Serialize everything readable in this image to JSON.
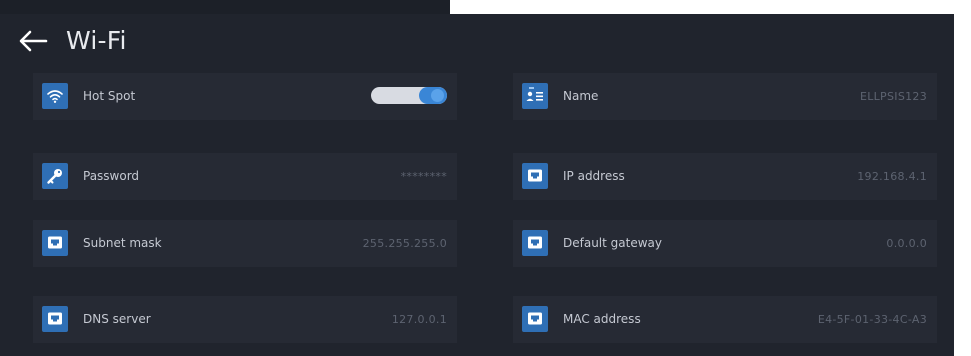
{
  "header": {
    "title": "Wi-Fi",
    "back_icon": "arrow-left-icon"
  },
  "settings": {
    "hotspot": {
      "label": "Hot Spot",
      "icon": "wifi-icon",
      "toggle_on": true
    },
    "name": {
      "label": "Name",
      "value": "ELLPSIS123",
      "icon": "id-card-icon"
    },
    "password": {
      "label": "Password",
      "value": "********",
      "icon": "key-icon"
    },
    "ip_address": {
      "label": "IP address",
      "value": "192.168.4.1",
      "icon": "network-port-icon"
    },
    "subnet_mask": {
      "label": "Subnet mask",
      "value": "255.255.255.0",
      "icon": "network-port-icon"
    },
    "default_gateway": {
      "label": "Default gateway",
      "value": "0.0.0.0",
      "icon": "network-port-icon"
    },
    "dns_server": {
      "label": "DNS server",
      "value": "127.0.0.1",
      "icon": "network-port-icon"
    },
    "mac_address": {
      "label": "MAC address",
      "value": "E4-5F-01-33-4C-A3",
      "icon": "network-port-icon"
    }
  },
  "colors": {
    "background": "#20242d",
    "row_background": "#262a34",
    "accent": "#2f6fb5",
    "toggle_on": "#3a86d6"
  }
}
